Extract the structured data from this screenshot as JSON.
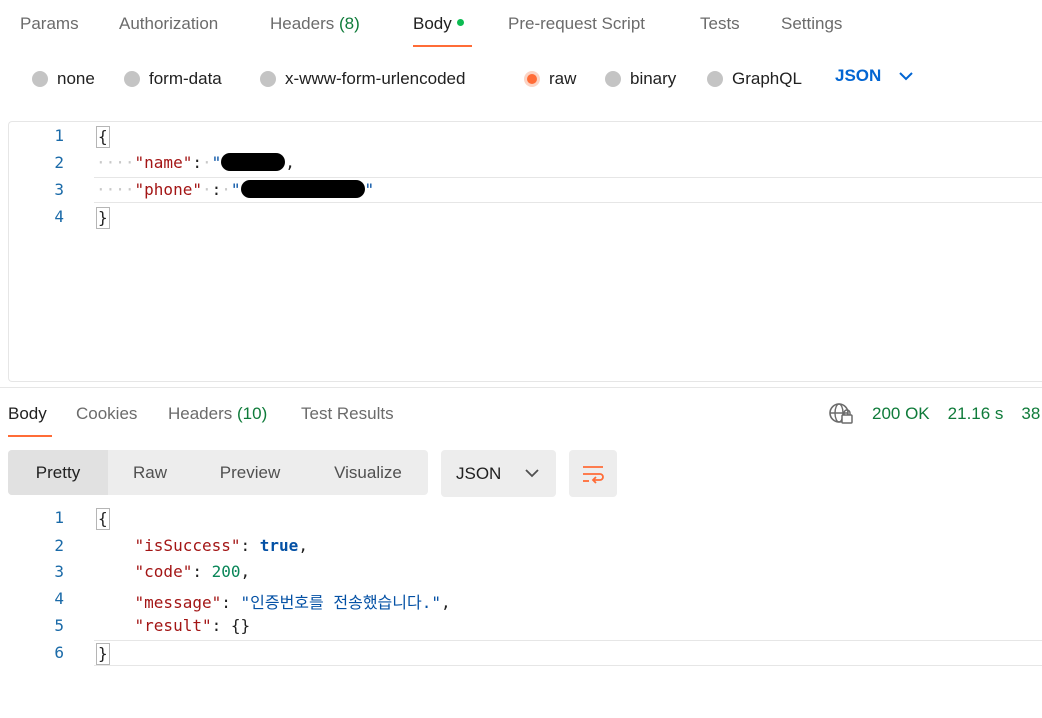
{
  "request_tabs": [
    {
      "label": "Params"
    },
    {
      "label": "Authorization"
    },
    {
      "label": "Headers",
      "count": "(8)"
    },
    {
      "label": "Body"
    },
    {
      "label": "Pre-request Script"
    },
    {
      "label": "Tests"
    },
    {
      "label": "Settings"
    }
  ],
  "body_types": [
    "none",
    "form-data",
    "x-www-form-urlencoded",
    "raw",
    "binary",
    "GraphQL"
  ],
  "body_type_selected": "raw",
  "body_lang": "JSON",
  "request_editor": {
    "line_numbers": [
      "1",
      "2",
      "3",
      "4"
    ],
    "open_brace": "{",
    "close_brace": "}",
    "name_key": "\"name\"",
    "phone_key": "\"phone\"",
    "colon": ":",
    "phone_tail": "\"",
    "comma": ","
  },
  "response_tabs": [
    {
      "label": "Body"
    },
    {
      "label": "Cookies"
    },
    {
      "label": "Headers",
      "count": "(10)"
    },
    {
      "label": "Test Results"
    }
  ],
  "response_status": {
    "status": "200 OK",
    "time": "21.16 s",
    "size": "38"
  },
  "view_modes": [
    "Pretty",
    "Raw",
    "Preview",
    "Visualize"
  ],
  "response_lang": "JSON",
  "response_editor": {
    "line_numbers": [
      "1",
      "2",
      "3",
      "4",
      "5",
      "6"
    ],
    "open_brace": "{",
    "close_brace": "}",
    "isSuccess_key": "\"isSuccess\"",
    "isSuccess_value": "true",
    "code_key": "\"code\"",
    "code_value": "200",
    "message_key": "\"message\"",
    "message_value": "\"인증번호를 전송했습니다.\"",
    "result_key": "\"result\"",
    "result_value": "{}",
    "colon": ":",
    "comma": ","
  },
  "colors": {
    "accent": "#ff6c37",
    "status_green": "#0f7b3a",
    "link_blue": "#0265d2"
  }
}
